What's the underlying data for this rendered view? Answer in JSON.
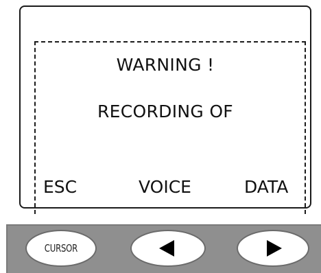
{
  "display": {
    "line1": "WARNING !",
    "line2": "RECORDING OF"
  },
  "softkeys": {
    "left": "ESC",
    "middle": "VOICE",
    "right": "DATA"
  },
  "buttons": {
    "cursor_label": "CURSOR",
    "left_arrow_icon": "left-triangle",
    "right_arrow_icon": "right-triangle"
  }
}
